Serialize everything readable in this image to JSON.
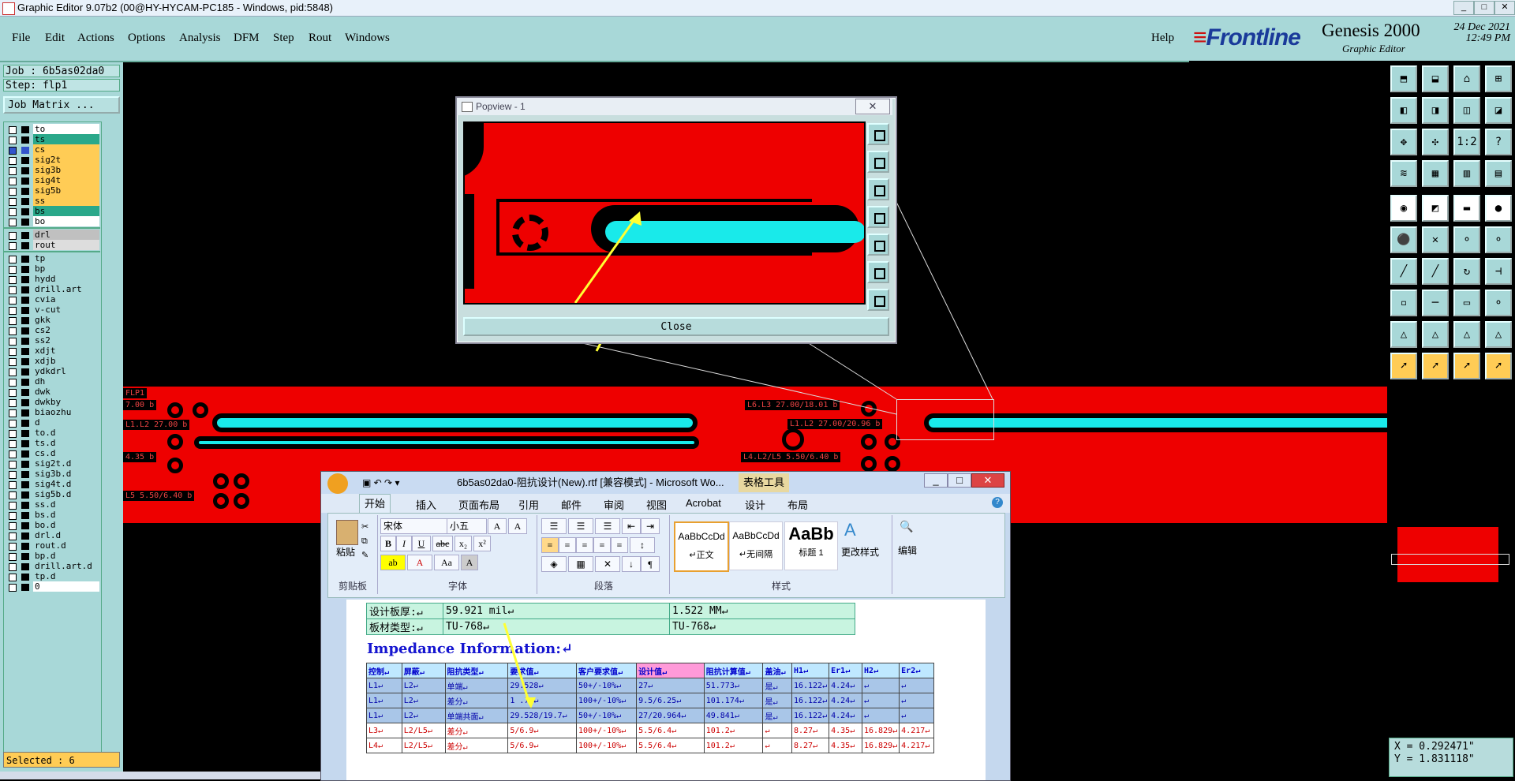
{
  "window": {
    "title": "Graphic Editor 9.07b2 (00@HY-HYCAM-PC185 - Windows, pid:5848)",
    "min": "_",
    "max": "□",
    "close": "✕"
  },
  "menu": {
    "items": [
      "File",
      "Edit",
      "Actions",
      "Options",
      "Analysis",
      "DFM",
      "Step",
      "Rout",
      "Windows"
    ],
    "help": "Help"
  },
  "brand": {
    "logo": "Frontline",
    "product": "Genesis 2000",
    "subtitle": "Graphic Editor",
    "date": "24 Dec 2021",
    "time": "12:49 PM"
  },
  "job": {
    "job_line": "Job : 6b5as02da0",
    "step_line": "Step: flp1",
    "matrix_button": "Job Matrix ..."
  },
  "layers": [
    {
      "name": "to",
      "color": "#ffffff"
    },
    {
      "name": "ts",
      "color": "#2aa88a"
    },
    {
      "name": "cs",
      "color": "#ffcc55"
    },
    {
      "name": "sig2t",
      "color": "#ffcc55"
    },
    {
      "name": "sig3b",
      "color": "#ffcc55"
    },
    {
      "name": "sig4t",
      "color": "#ffcc55"
    },
    {
      "name": "sig5b",
      "color": "#ffcc55"
    },
    {
      "name": "ss",
      "color": "#ffcc55"
    },
    {
      "name": "bs",
      "color": "#2aa88a"
    },
    {
      "name": "bo",
      "color": "#ffffff"
    },
    {
      "name": "drl",
      "color": "#c0c0c0"
    },
    {
      "name": "rout",
      "color": "#dddddd"
    },
    {
      "name": "tp",
      "color": "#a8d8d8"
    },
    {
      "name": "bp",
      "color": "#a8d8d8"
    },
    {
      "name": "hydd",
      "color": "#a8d8d8"
    },
    {
      "name": "drill.art",
      "color": "#a8d8d8"
    },
    {
      "name": "cvia",
      "color": "#a8d8d8"
    },
    {
      "name": "v-cut",
      "color": "#a8d8d8"
    },
    {
      "name": "gkk",
      "color": "#a8d8d8"
    },
    {
      "name": "cs2",
      "color": "#a8d8d8"
    },
    {
      "name": "ss2",
      "color": "#a8d8d8"
    },
    {
      "name": "xdjt",
      "color": "#a8d8d8"
    },
    {
      "name": "xdjb",
      "color": "#a8d8d8"
    },
    {
      "name": "ydkdrl",
      "color": "#a8d8d8"
    },
    {
      "name": "dh",
      "color": "#a8d8d8"
    },
    {
      "name": "dwk",
      "color": "#a8d8d8"
    },
    {
      "name": "dwkby",
      "color": "#a8d8d8"
    },
    {
      "name": "biaozhu",
      "color": "#a8d8d8"
    },
    {
      "name": "d",
      "color": "#a8d8d8"
    },
    {
      "name": "to.d",
      "color": "#a8d8d8"
    },
    {
      "name": "ts.d",
      "color": "#a8d8d8"
    },
    {
      "name": "cs.d",
      "color": "#a8d8d8"
    },
    {
      "name": "sig2t.d",
      "color": "#a8d8d8"
    },
    {
      "name": "sig3b.d",
      "color": "#a8d8d8"
    },
    {
      "name": "sig4t.d",
      "color": "#a8d8d8"
    },
    {
      "name": "sig5b.d",
      "color": "#a8d8d8"
    },
    {
      "name": "ss.d",
      "color": "#a8d8d8"
    },
    {
      "name": "bs.d",
      "color": "#a8d8d8"
    },
    {
      "name": "bo.d",
      "color": "#a8d8d8"
    },
    {
      "name": "drl.d",
      "color": "#a8d8d8"
    },
    {
      "name": "rout.d",
      "color": "#a8d8d8"
    },
    {
      "name": "bp.d",
      "color": "#a8d8d8"
    },
    {
      "name": "drill.art.d",
      "color": "#a8d8d8"
    },
    {
      "name": "tp.d",
      "color": "#a8d8d8"
    },
    {
      "name": "0",
      "color": "#ffffff"
    }
  ],
  "status": {
    "selected": "Selected : 6"
  },
  "canvas": {
    "labels": [
      "FLP1",
      "7.00 b",
      "L1.L2 27.00 b",
      "4.35 b",
      "L5 5.50/6.40 b",
      "L6.L3 27.00/18.01 b",
      "L1.L2 27.00/20.96 b",
      "L4.L2/L5 5.50/6.40 b"
    ]
  },
  "popview": {
    "title": "Popview - 1",
    "close_label": "Close"
  },
  "coords": {
    "x": "X = 0.292471\"",
    "y": "Y = 1.831118\""
  },
  "word": {
    "title": "6b5as02da0-阻抗设计(New).rtf [兼容模式] - Microsoft Wo...",
    "context_tab": "表格工具",
    "tabs": [
      "开始",
      "插入",
      "页面布局",
      "引用",
      "邮件",
      "审阅",
      "视图",
      "Acrobat",
      "设计",
      "布局"
    ],
    "clipboard": {
      "paste": "粘贴",
      "label": "剪贴板"
    },
    "font": {
      "name": "宋体",
      "size": "小五",
      "label": "字体"
    },
    "paragraph_label": "段落",
    "styles": {
      "label": "样式",
      "items": [
        {
          "preview": "AaBbCcDd",
          "name": "↵正文"
        },
        {
          "preview": "AaBbCcDd",
          "name": "↵无间隔"
        },
        {
          "preview": "AaBb",
          "name": "标题 1"
        }
      ],
      "change": "更改样式",
      "edit": "编辑"
    },
    "info_rows": [
      [
        "设计板厚:↵",
        "59.921 mil↵",
        "1.522 MM↵"
      ],
      [
        "板材类型:↵",
        "TU-768↵",
        "TU-768↵"
      ]
    ],
    "heading": "Impedance Information:↵",
    "table_header": [
      "控制↵",
      "屏蔽↵",
      "阻抗类型↵",
      "要求值↵",
      "客户要求值↵",
      "设计值↵",
      "阻抗计算值↵",
      "盖油↵",
      "H1↵",
      "Er1↵",
      "H2↵",
      "Er2↵"
    ],
    "table_rows": [
      {
        "style": "sel",
        "cells": [
          "L1↵",
          "L2↵",
          "单端↵",
          "29.528↵",
          "50+/-10%↵",
          "27↵",
          "51.773↵",
          "是↵",
          "16.122↵",
          "4.24↵",
          "↵",
          "↵"
        ]
      },
      {
        "style": "sel",
        "cells": [
          "L1↵",
          "L2↵",
          "差分↵",
          "1 .75↵",
          "100+/-10%↵",
          "9.5/6.25↵",
          "101.174↵",
          "是↵",
          "16.122↵",
          "4.24↵",
          "↵",
          "↵"
        ]
      },
      {
        "style": "sel",
        "cells": [
          "L1↵",
          "L2↵",
          "单端共面↵",
          "29.528/19.7↵",
          "50+/-10%↵",
          "27/20.964↵",
          "49.841↵",
          "是↵",
          "16.122↵",
          "4.24↵",
          "↵",
          "↵"
        ]
      },
      {
        "style": "red",
        "cells": [
          "L3↵",
          "L2/L5↵",
          "差分↵",
          "5/6.9↵",
          "100+/-10%↵",
          "5.5/6.4↵",
          "101.2↵",
          "↵",
          "8.27↵",
          "4.35↵",
          "16.829↵",
          "4.217↵"
        ]
      },
      {
        "style": "red",
        "cells": [
          "L4↵",
          "L2/L5↵",
          "差分↵",
          "5/6.9↵",
          "100+/-10%↵",
          "5.5/6.4↵",
          "101.2↵",
          "↵",
          "8.27↵",
          "4.35↵",
          "16.829↵",
          "4.217↵"
        ]
      }
    ]
  }
}
